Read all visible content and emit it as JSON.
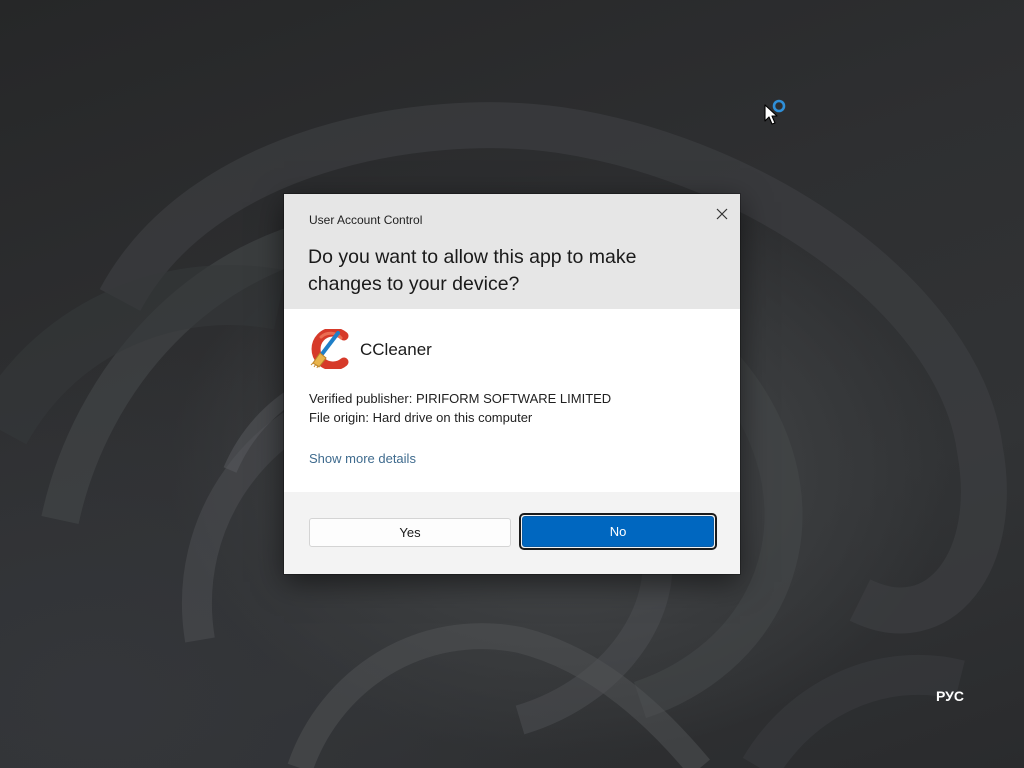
{
  "window": {
    "title": "User Account Control",
    "close_icon": "close-icon"
  },
  "prompt": {
    "question": "Do you want to allow this app to make changes to your device?"
  },
  "app": {
    "name": "CCleaner",
    "icon": "ccleaner-icon",
    "publisher": "Verified publisher: PIRIFORM SOFTWARE LIMITED",
    "origin": "File origin: Hard drive on this computer",
    "details_link": "Show more details"
  },
  "buttons": {
    "yes": "Yes",
    "no": "No"
  },
  "system": {
    "language_indicator": "РУС",
    "cursor_icon": "busy-pointer-icon"
  },
  "colors": {
    "accent": "#0067c0",
    "link": "#3f6b8e",
    "header_bg": "#e6e6e6",
    "body_bg": "#ffffff",
    "footer_bg": "#f3f3f3"
  }
}
